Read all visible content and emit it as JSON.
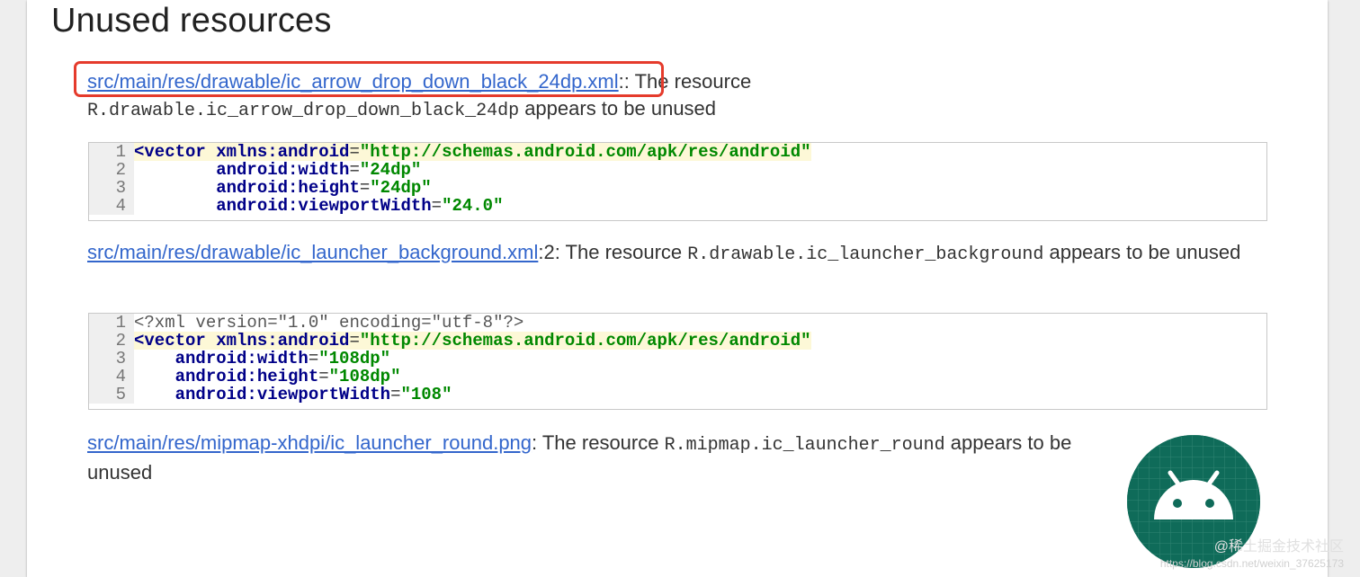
{
  "section": {
    "title": "Unused resources"
  },
  "issues": [
    {
      "link": "src/main/res/drawable/ic_arrow_drop_down_black_24dp.xml",
      "line_suffix": ":",
      "text_before": ": The resource ",
      "resource": "R.drawable.ic_arrow_drop_down_black_24dp",
      "text_after": " appears to be unused",
      "code": [
        {
          "n": "1",
          "parts": [
            [
              "tag",
              "<vector "
            ],
            [
              "attr",
              "xmlns:android"
            ],
            [
              "plain",
              "="
            ],
            [
              "val",
              "\"http://schemas.android.com/apk/res/android\""
            ]
          ]
        },
        {
          "n": "2",
          "parts": [
            [
              "plain",
              "        "
            ],
            [
              "attr",
              "android:width"
            ],
            [
              "plain",
              "="
            ],
            [
              "val",
              "\"24dp\""
            ]
          ]
        },
        {
          "n": "3",
          "parts": [
            [
              "plain",
              "        "
            ],
            [
              "attr",
              "android:height"
            ],
            [
              "plain",
              "="
            ],
            [
              "val",
              "\"24dp\""
            ]
          ]
        },
        {
          "n": "4",
          "parts": [
            [
              "plain",
              "        "
            ],
            [
              "attr",
              "android:viewportWidth"
            ],
            [
              "plain",
              "="
            ],
            [
              "val",
              "\"24.0\""
            ]
          ]
        }
      ]
    },
    {
      "link": "src/main/res/drawable/ic_launcher_background.xml",
      "line_suffix": ":2",
      "text_before": ": The resource ",
      "resource": "R.drawable.ic_launcher_background",
      "text_after": " appears to be unused",
      "code": [
        {
          "n": "1",
          "parts": [
            [
              "dec",
              "<?xml version=\"1.0\" encoding=\"utf-8\"?>"
            ]
          ]
        },
        {
          "n": "2",
          "parts": [
            [
              "tag",
              "<vector "
            ],
            [
              "attr",
              "xmlns:android"
            ],
            [
              "plain",
              "="
            ],
            [
              "val",
              "\"http://schemas.android.com/apk/res/android\""
            ]
          ]
        },
        {
          "n": "3",
          "parts": [
            [
              "plain",
              "    "
            ],
            [
              "attr",
              "android:width"
            ],
            [
              "plain",
              "="
            ],
            [
              "val",
              "\"108dp\""
            ]
          ]
        },
        {
          "n": "4",
          "parts": [
            [
              "plain",
              "    "
            ],
            [
              "attr",
              "android:height"
            ],
            [
              "plain",
              "="
            ],
            [
              "val",
              "\"108dp\""
            ]
          ]
        },
        {
          "n": "5",
          "parts": [
            [
              "plain",
              "    "
            ],
            [
              "attr",
              "android:viewportWidth"
            ],
            [
              "plain",
              "="
            ],
            [
              "val",
              "\"108\""
            ]
          ]
        }
      ]
    },
    {
      "link": "src/main/res/mipmap-xhdpi/ic_launcher_round.png",
      "line_suffix": "",
      "text_before": ": The resource ",
      "resource": "R.mipmap.ic_launcher_round",
      "text_after": " appears to be unused"
    }
  ],
  "icons": {
    "preview": "android-launcher-round-icon"
  },
  "colors": {
    "link": "#3366cc",
    "highlight_box": "#e53b2c",
    "icon_bg": "#0f6b59"
  },
  "watermark": {
    "text": "@稀土掘金技术社区",
    "url": "https://blog.csdn.net/weixin_37625173"
  }
}
